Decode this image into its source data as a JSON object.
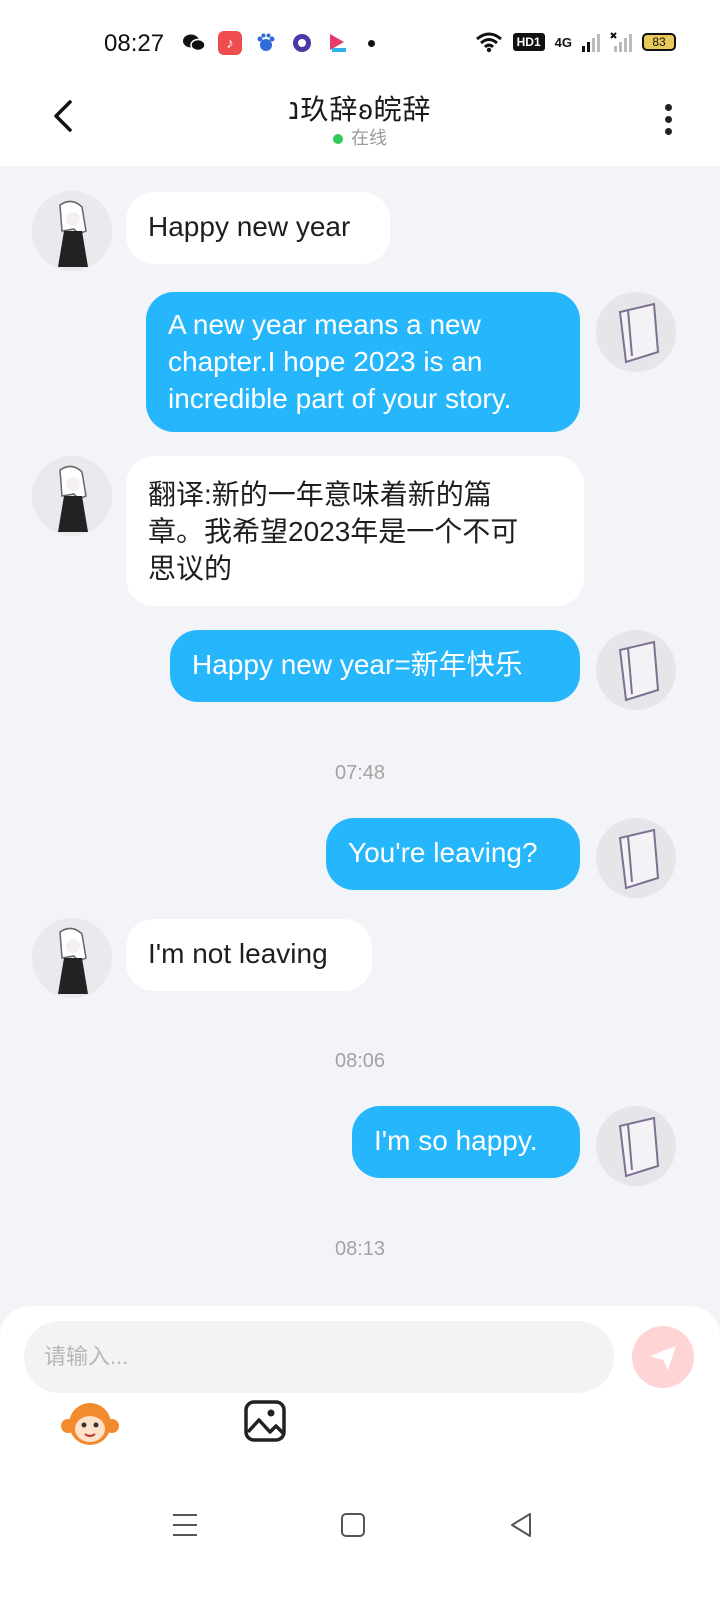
{
  "status_bar": {
    "time": "08:27",
    "hd": "HD1",
    "network": "4G",
    "battery": "83"
  },
  "header": {
    "title": "נ玖辞ʚ皖辞",
    "status": "在线"
  },
  "messages": [
    {
      "side": "in",
      "text": "Happy new year"
    },
    {
      "side": "out",
      "lines": [
        "A new year means a new",
        "chapter.I hope 2023 is an",
        "incredible part of your story."
      ]
    },
    {
      "side": "in",
      "lines": [
        "翻译:新的一年意味着新的篇",
        "章。我希望2023年是一个不可",
        "思议的"
      ]
    },
    {
      "side": "out",
      "text": "Happy new year=新年快乐"
    },
    {
      "timestamp": "07:48"
    },
    {
      "side": "out",
      "text": "You're leaving?"
    },
    {
      "side": "in",
      "text": "I'm not leaving"
    },
    {
      "timestamp": "08:06"
    },
    {
      "side": "out",
      "text": "I'm so happy."
    },
    {
      "timestamp": "08:13"
    }
  ],
  "composer": {
    "placeholder": "请输入..."
  },
  "colors": {
    "outgoing": "#26b6fb",
    "incoming": "#ffffff",
    "online": "#30c95a",
    "send_disabled": "#ffd4d4"
  }
}
